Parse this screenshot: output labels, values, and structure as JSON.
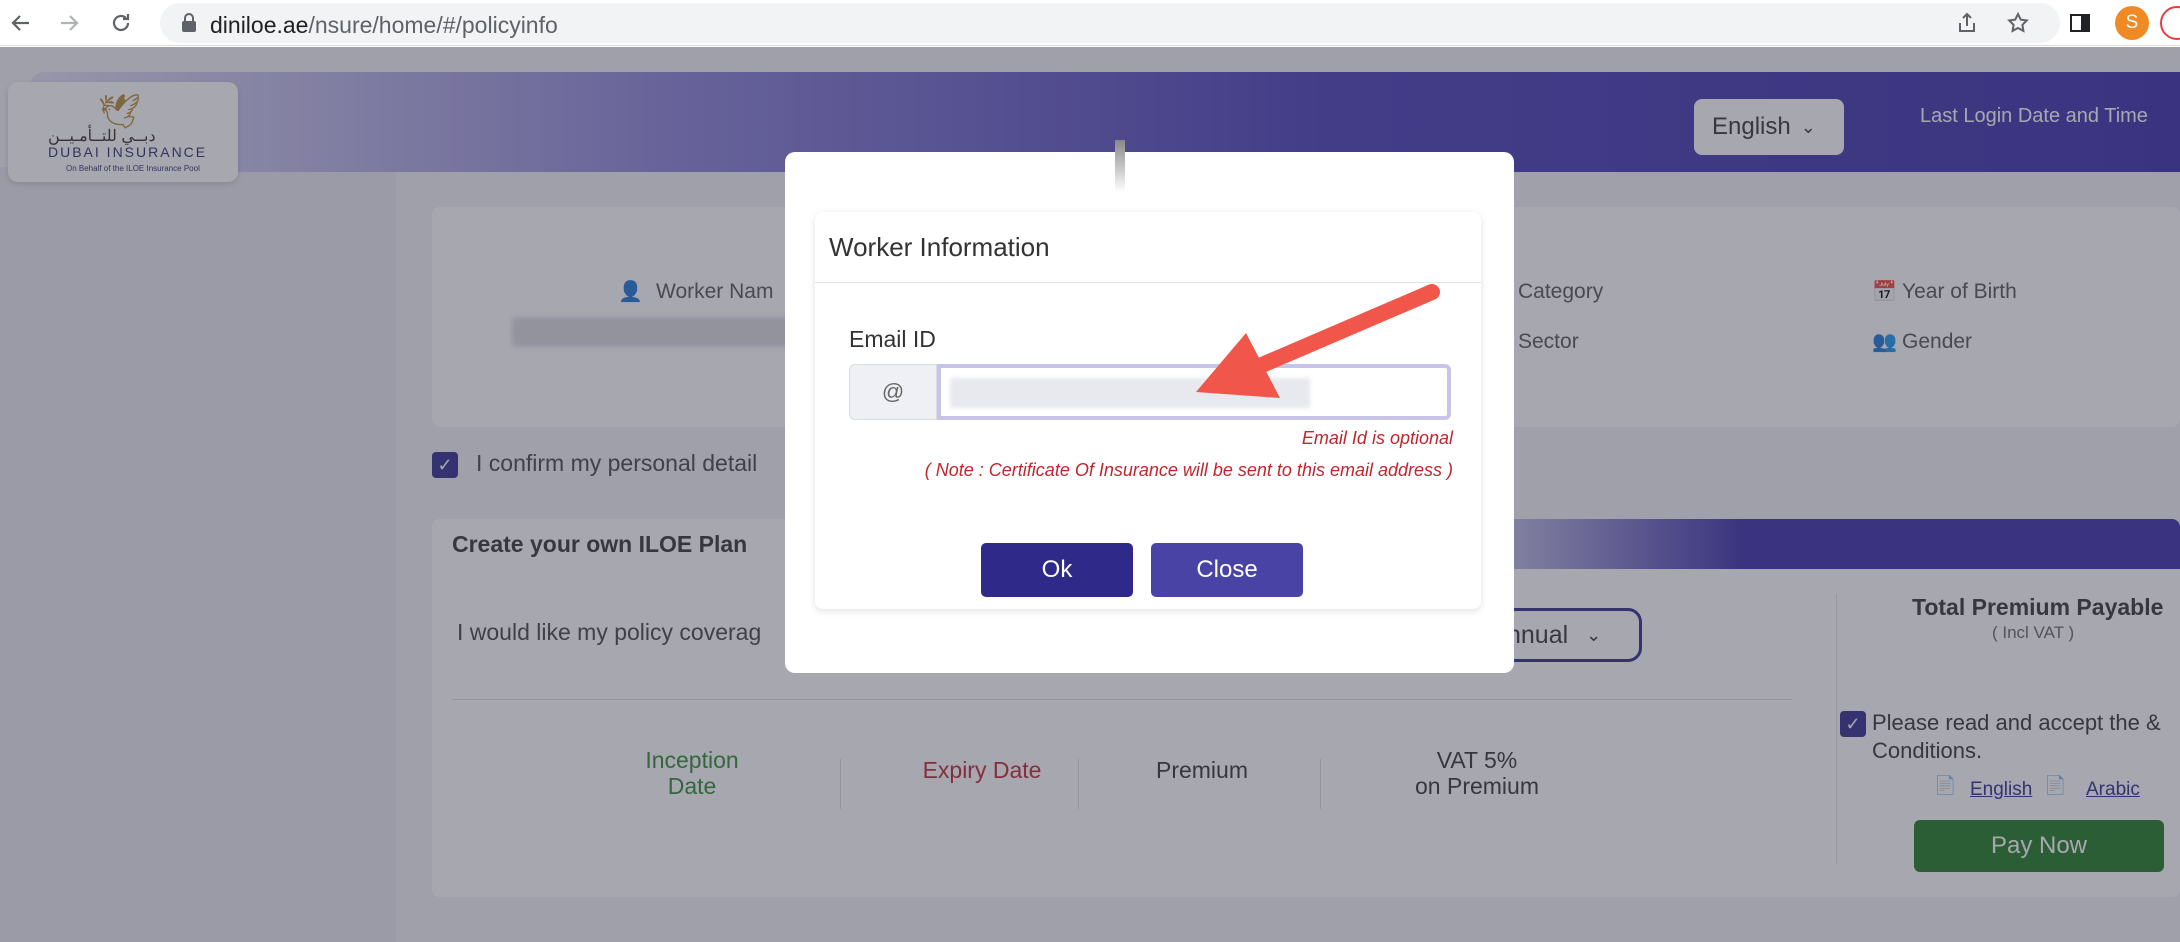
{
  "browser": {
    "url_host": "diniloe.ae",
    "url_path": "/nsure/home/#/policyinfo",
    "profile_initial": "S"
  },
  "header": {
    "logo_arabic": "دبــي للتــأمـيــن",
    "logo_english": "DUBAI INSURANCE",
    "logo_subtitle": "On Behalf of the ILOE Insurance Pool",
    "language": "English",
    "last_login_label": "Last Login Date and Time"
  },
  "worker_card": {
    "worker_name_label": "Worker Nam",
    "category_label": "Category",
    "year_of_birth_label": "Year of Birth",
    "sector_label": "Sector",
    "gender_label": "Gender"
  },
  "confirm": {
    "text": "I confirm my personal detail"
  },
  "plan": {
    "title": "Create your own ILOE Plan",
    "coverage_text": "I would like my policy coverag",
    "frequency": "nnual",
    "inception_date": "Inception Date",
    "expiry_date": "Expiry Date",
    "premium": "Premium",
    "vat_line1": "VAT 5%",
    "vat_line2": "on Premium",
    "total_premium": "Total Premium Payable",
    "incl_vat": "( Incl VAT )",
    "terms": "Please read and accept the & Conditions.",
    "link_english": "English",
    "link_arabic": "Arabic",
    "pay_now": "Pay Now"
  },
  "modal": {
    "title": "Worker Information",
    "email_label": "Email ID",
    "at_symbol": "@",
    "email_value": "",
    "optional_note": "Email Id is optional",
    "certificate_note": "( Note : Certificate Of Insurance will be sent to this email address )",
    "ok_label": "Ok",
    "close_label": "Close"
  },
  "colors": {
    "primary": "#2f2a8a",
    "error": "#c0262d",
    "pay": "#1f7a1f",
    "arrow": "#f0564a"
  }
}
